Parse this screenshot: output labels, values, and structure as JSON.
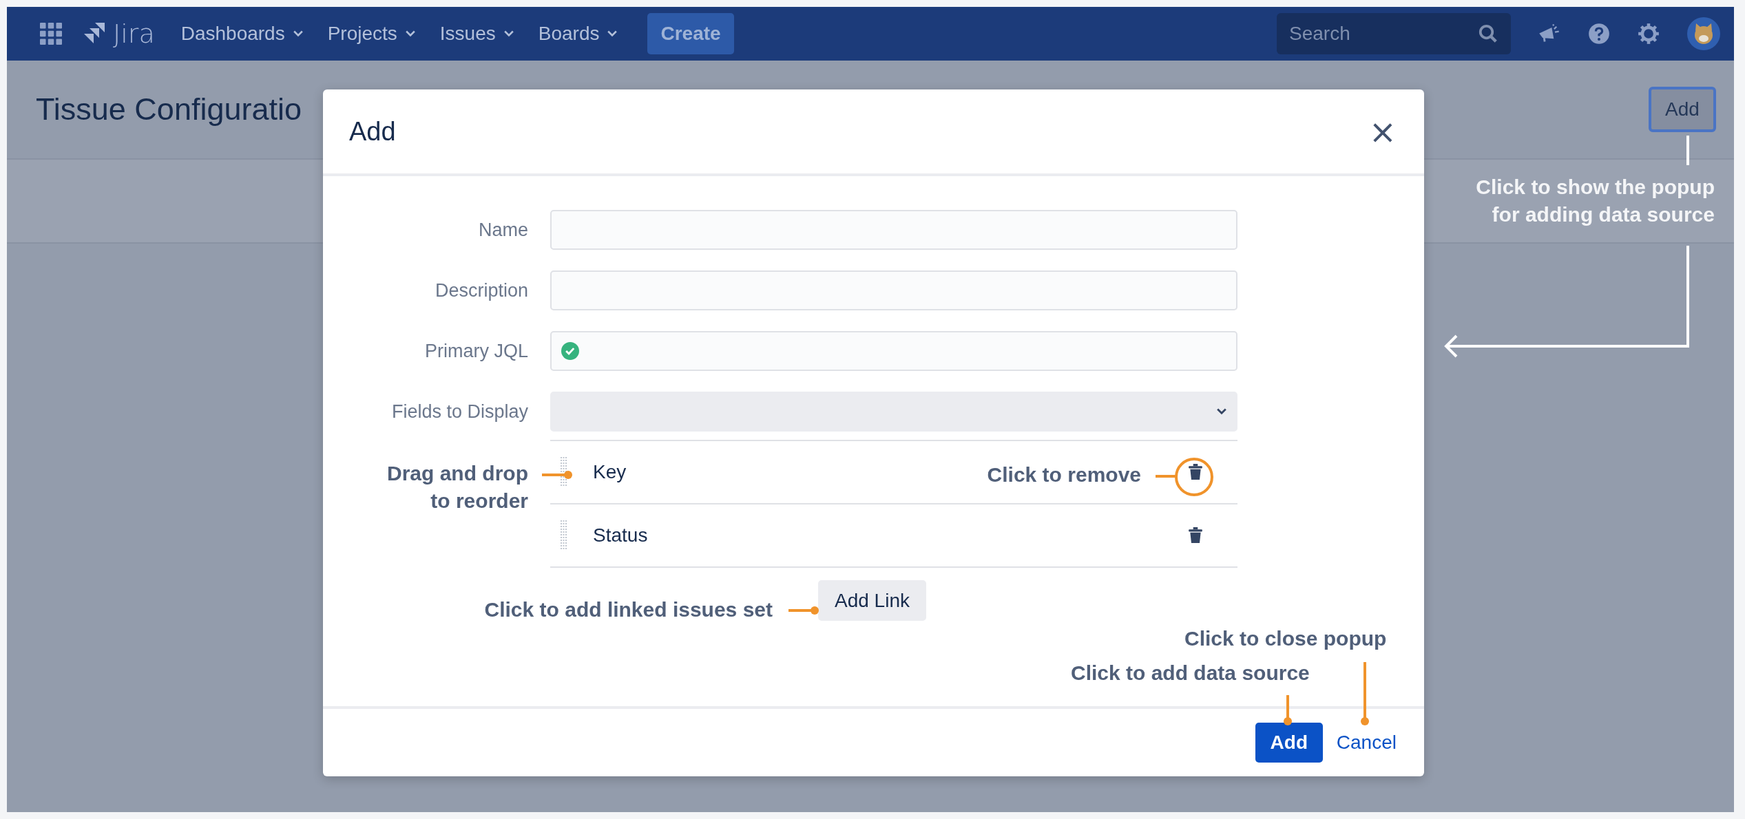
{
  "navbar": {
    "logo": "Jira",
    "menus": [
      {
        "label": "Dashboards"
      },
      {
        "label": "Projects"
      },
      {
        "label": "Issues"
      },
      {
        "label": "Boards"
      }
    ],
    "create": "Create",
    "search": {
      "placeholder": "Search"
    }
  },
  "page": {
    "title": "Tissue Configuratio",
    "add_button": "Add"
  },
  "dialog": {
    "title": "Add",
    "close": "×",
    "fields": [
      {
        "label": "Name",
        "kind": "text"
      },
      {
        "label": "Description",
        "kind": "text"
      },
      {
        "label": "Primary JQL",
        "kind": "jql",
        "valid": true
      },
      {
        "label": "Fields to Display",
        "kind": "select"
      }
    ],
    "display_fields": [
      {
        "label": "Key"
      },
      {
        "label": "Status"
      }
    ],
    "add_link": "Add Link",
    "primary": "Add",
    "cancel": "Cancel"
  },
  "annotations": [
    {
      "text": "Click to show the popup\nfor adding data source"
    },
    {
      "text": "Drag and drop\nto reorder"
    },
    {
      "text": "Click to remove"
    },
    {
      "text": "Click to add linked issues set"
    },
    {
      "text": "Click to close popup"
    },
    {
      "text": "Click to add data source"
    }
  ]
}
